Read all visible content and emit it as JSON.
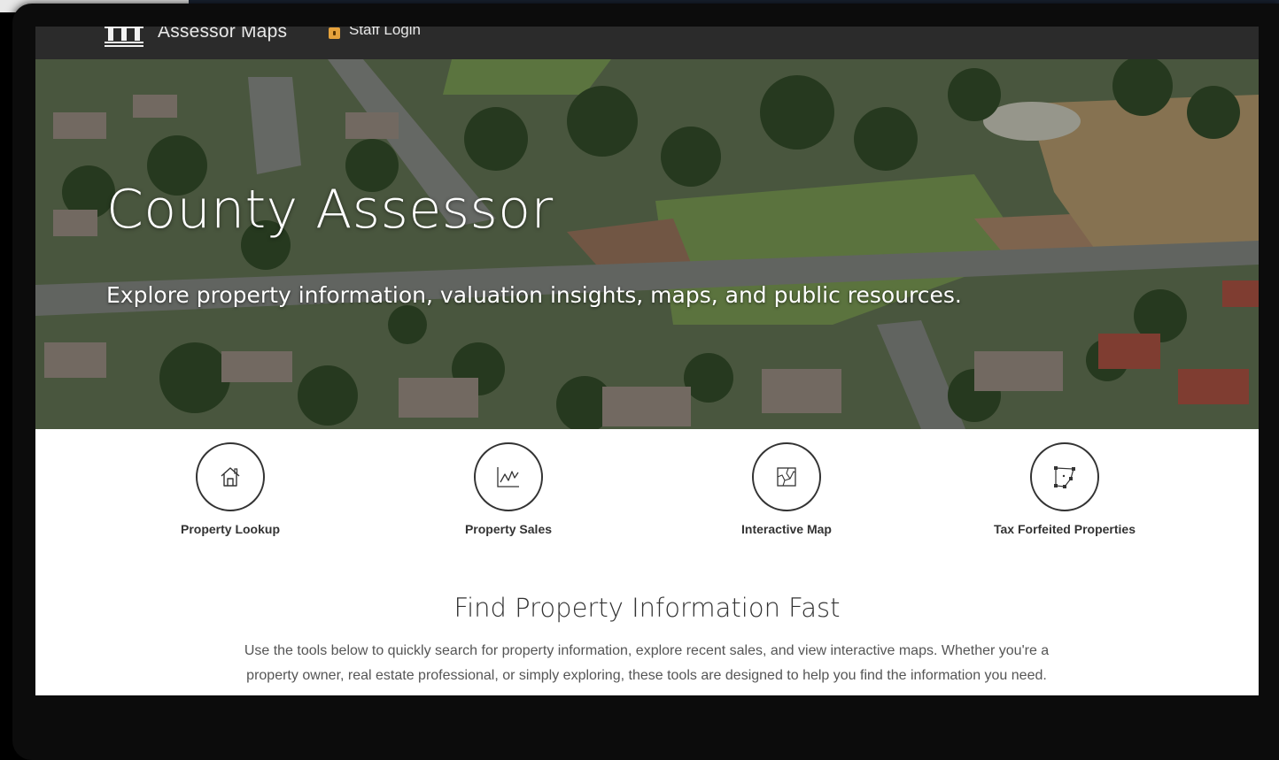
{
  "navbar": {
    "brand_name": "Assessor Maps",
    "staff_login_label": "Staff Login"
  },
  "hero": {
    "title": "County Assessor",
    "subtitle": "Explore property information, valuation insights, maps, and public resources."
  },
  "tools": [
    {
      "label": "Property Lookup",
      "icon": "house-icon"
    },
    {
      "label": "Property Sales",
      "icon": "sales-chart-icon"
    },
    {
      "label": "Interactive Map",
      "icon": "map-icon"
    },
    {
      "label": "Tax Forfeited Properties",
      "icon": "parcel-polygon-icon"
    }
  ],
  "info": {
    "title": "Find Property Information Fast",
    "body": "Use the tools below to quickly search for property information, explore recent sales, and view interactive maps. Whether you're a property owner, real estate professional, or simply exploring, these tools are designed to help you find the information you need."
  },
  "colors": {
    "navbar_bg": "#2b2b2b",
    "lock_accent": "#e6a23c",
    "text_dark": "#333333"
  }
}
